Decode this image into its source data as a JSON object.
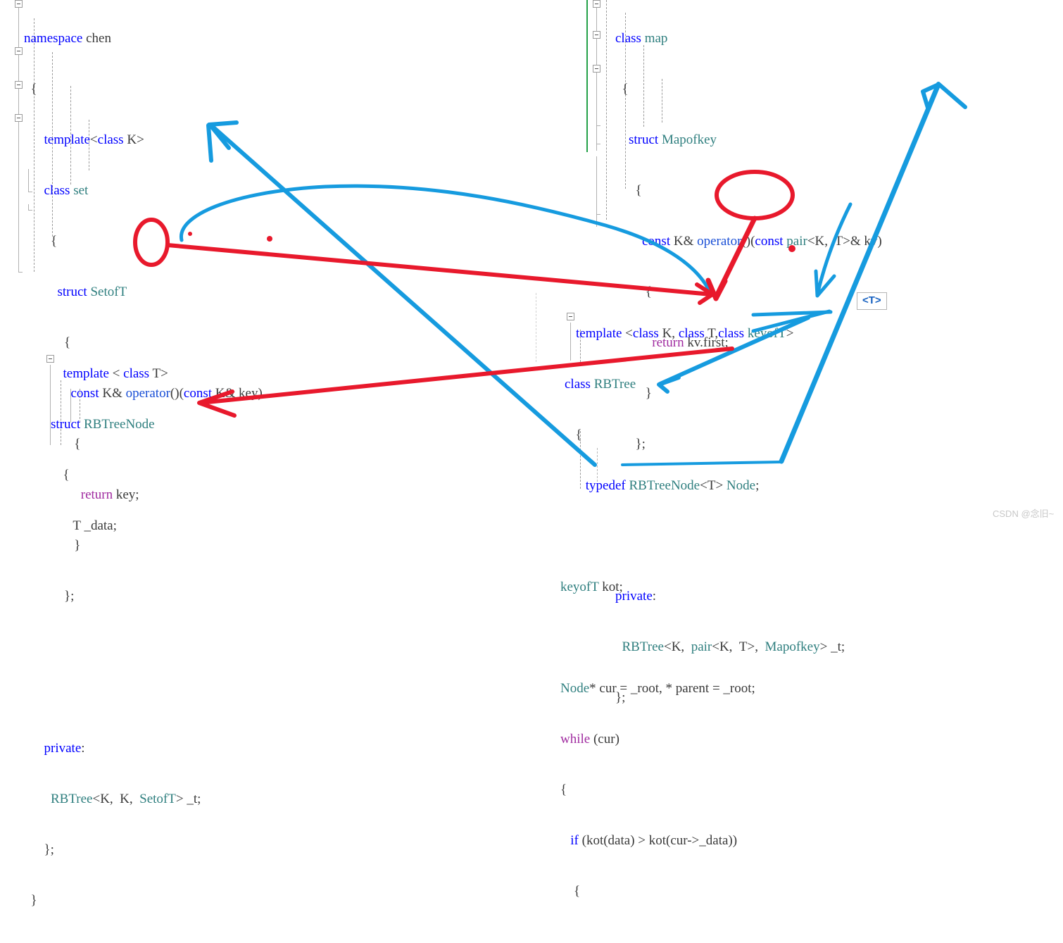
{
  "editor": {
    "background": "#ffffff",
    "colors": {
      "keyword": "#0000ff",
      "type": "#2f7f7f",
      "control": "#a02ba0",
      "text": "#3a3a3a",
      "annotation_red": "#e8192c",
      "annotation_blue": "#169bdf",
      "changed_line_green": "#24a148",
      "guide_gray": "#9b9b9b"
    }
  },
  "blocks": {
    "set_block": {
      "name": "set-class-code-block",
      "lines": [
        "namespace chen",
        "{",
        "    template<class K>",
        "    class set",
        "    {",
        "        struct SetofT",
        "        {",
        "            const K& operator()(const K& key)",
        "            {",
        "                return key;",
        "            }",
        "        };",
        "",
        "    private:",
        "        RBTree<K, K, SetofT> _t;",
        "    };",
        "}"
      ]
    },
    "map_block": {
      "name": "map-class-code-block",
      "lines": [
        "    class map",
        "    {",
        "        struct Mapofkey",
        "        {",
        "            const K& operator()(const pair<K, T>& kv)",
        "            {",
        "                return kv.first;",
        "            }",
        "        };",
        "",
        "",
        "    private:",
        "        RBTree<K, pair<K, T>, Mapofkey> _t;",
        "    };"
      ]
    },
    "rbtreenode_block": {
      "name": "rbtreenode-struct-code-block",
      "lines": [
        "  template < class T>",
        "struct RBTreeNode",
        "  {",
        "      T _data;",
        "",
        ""
      ]
    },
    "rbtree_block": {
      "name": "rbtree-class-code-block",
      "lines": [
        "   template <class K, class T,class keyofT>",
        " class RBTree",
        "   {",
        "       typedef RBTreeNode<T> Node;",
        "",
        "   keyofT kot;",
        "",
        "   Node* cur = _root, * parent = _root;",
        "   while (cur)",
        "   {",
        "       if (kot(data) > kot(cur->_data))",
        "       {"
      ]
    }
  },
  "tooltip": {
    "label": "<T>"
  },
  "annotations": {
    "red_ellipse_set": "RBTree<K, K, SetofT> second parameter K circled",
    "red_ellipse_map": "RBTree<K, pair<K, T>, Mapofkey> second parameter pair<K, T> circled",
    "red_arrow_set_to_template": "from circled K in set to template <class K, class T, class keyofT>",
    "red_arrow_map_to_template": "from circled pair<K,T> in map down to class T of RBTree template",
    "red_arrow_to_data": "from RBTree typedef area left to T _data;",
    "blue_arrow_to_set_operator": "points to const K& operator()(const K& key)",
    "blue_arrow_to_map_operator": "points to const K& operator()(const pair<K, T>& kv)",
    "blue_curve_set_to_private": "curve from SetofT _t to map private RBTree line",
    "blue_arrow_to_keyoft": "arrow pointing to class keyofT in RBTree template",
    "blue_arrow_to_kot": "arrow pointing to keyofT kot;",
    "blue_underline_keyoft": "underline under class keyofT",
    "blue_underline_kot_call": "underline under kot(data) > kot(",
    "red_dot_left": "red dot right of SetofT _t;",
    "red_dot_right": "red dot right of Mapofkey _t;"
  },
  "watermark": {
    "text": "CSDN @念旧~"
  }
}
